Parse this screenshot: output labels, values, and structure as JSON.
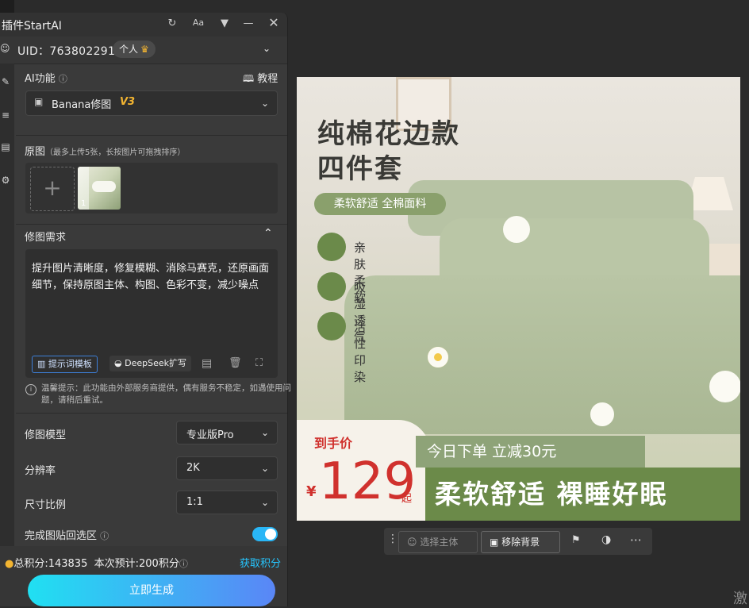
{
  "window": {
    "title": "插件StartAI"
  },
  "user": {
    "uid_label": "UID：763802291",
    "plan": "个人"
  },
  "ai_feature": {
    "label": "AI功能",
    "tutorial": "教程",
    "selected_tool": "Banana修图",
    "version": "V3"
  },
  "source_images": {
    "label": "原图",
    "hint": "（最多上传5张，长按图片可拖拽排序）",
    "thumb_index": "1"
  },
  "edit_request": {
    "label": "修图需求",
    "text": "提升图片清晰度，修复模糊、消除马赛克，还原画面细节，保持原图主体、构图、色彩不变，减少噪点",
    "prompt_template_btn": "提示词模板",
    "deepseek_btn": "DeepSeek扩写"
  },
  "notice": "温馨提示：此功能由外部服务商提供，偶有服务不稳定，如遇使用问题，请稍后重试。",
  "settings": {
    "model_label": "修图模型",
    "model_value": "专业版Pro",
    "resolution_label": "分辨率",
    "resolution_value": "2K",
    "ratio_label": "尺寸比例",
    "ratio_value": "1:1",
    "paste_back_label": "完成图贴回选区",
    "paste_back_on": true
  },
  "footer": {
    "total_points": "总积分:143835",
    "estimate": "本次预计:200积分",
    "get_points": "获取积分",
    "generate": "立即生成"
  },
  "product": {
    "title_line1": "纯棉花边款",
    "title_line2": "四件套",
    "tagline": "柔软舒适 全棉面料",
    "features": [
      "亲肤柔软",
      "吸湿透气",
      "活性印染"
    ],
    "price_label": "到手价",
    "currency": "¥",
    "price": "129",
    "price_suffix": "起",
    "promo": "今日下单  立减30元",
    "slogan": "柔软舒适  裸睡好眠"
  },
  "image_toolbar": {
    "select_subject": "选择主体",
    "remove_bg": "移除背景"
  },
  "edge_text": "激"
}
